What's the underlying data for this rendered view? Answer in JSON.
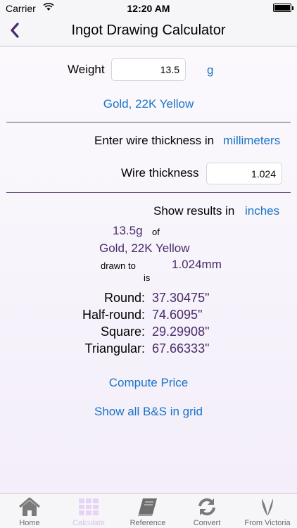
{
  "status": {
    "carrier": "Carrier",
    "time": "12:20 AM"
  },
  "nav": {
    "title": "Ingot Drawing Calculator"
  },
  "form": {
    "weight_label": "Weight",
    "weight_value": "13.5",
    "weight_unit": "g",
    "metal": "Gold, 22K Yellow",
    "thickness_prompt": "Enter wire thickness in",
    "thickness_unit": "millimeters",
    "thickness_label": "Wire thickness",
    "thickness_value": "1.024",
    "results_prompt": "Show results in",
    "results_unit": "inches"
  },
  "summary": {
    "weight": "13.5g",
    "of": "of",
    "metal": "Gold, 22K Yellow",
    "drawn_to": "drawn to",
    "thickness": "1.024mm",
    "is": "is"
  },
  "results": [
    {
      "label": "Round:",
      "value": "37.30475\""
    },
    {
      "label": "Half-round:",
      "value": "74.6095\""
    },
    {
      "label": "Square:",
      "value": "29.29908\""
    },
    {
      "label": "Triangular:",
      "value": "67.66333\""
    }
  ],
  "actions": {
    "compute_price": "Compute Price",
    "show_grid": "Show all B&S in grid"
  },
  "tabs": [
    {
      "label": "Home",
      "icon": "home-icon"
    },
    {
      "label": "Calculate",
      "icon": "grid-icon"
    },
    {
      "label": "Reference",
      "icon": "book-icon"
    },
    {
      "label": "Convert",
      "icon": "refresh-icon"
    },
    {
      "label": "From Victoria",
      "icon": "logo-icon"
    }
  ],
  "colors": {
    "accent": "#1a73c8",
    "result_text": "#4a2a6a",
    "divider": "#6a4c7e",
    "active_tab": "#d8c1f0"
  }
}
